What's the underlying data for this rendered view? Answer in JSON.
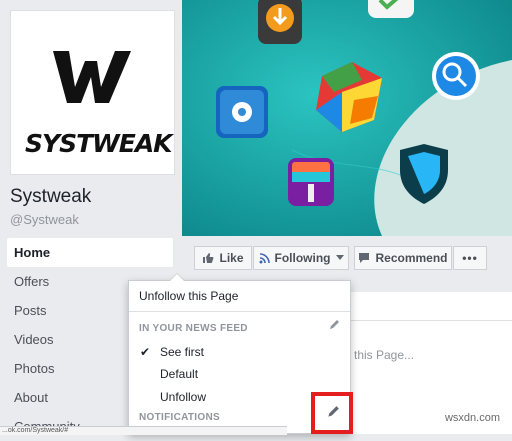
{
  "profile": {
    "logo_text": "SYSTWEAK",
    "name": "Systweak",
    "handle": "@Systweak"
  },
  "nav": {
    "items": [
      {
        "label": "Home",
        "active": true
      },
      {
        "label": "Offers"
      },
      {
        "label": "Posts"
      },
      {
        "label": "Videos"
      },
      {
        "label": "Photos"
      },
      {
        "label": "About"
      },
      {
        "label": "Community"
      }
    ]
  },
  "actions": {
    "like": "Like",
    "following": "Following",
    "recommend": "Recommend",
    "more": "•••"
  },
  "dropdown": {
    "unfollow_page": "Unfollow this Page",
    "news_feed_header": "IN YOUR NEWS FEED",
    "options": [
      "See first",
      "Default",
      "Unfollow"
    ],
    "selected": "See first",
    "notifications_header": "NOTIFICATIONS"
  },
  "right_panel": {
    "partial_text": "this Page..."
  },
  "status_bar": {
    "url": "...ok.com/Systweak/#"
  },
  "watermark": "wsxdn.com",
  "colors": {
    "cover_teal": "#1aa6a4",
    "highlight_red": "#e41e1e",
    "facebook_blue": "#4267b2"
  }
}
